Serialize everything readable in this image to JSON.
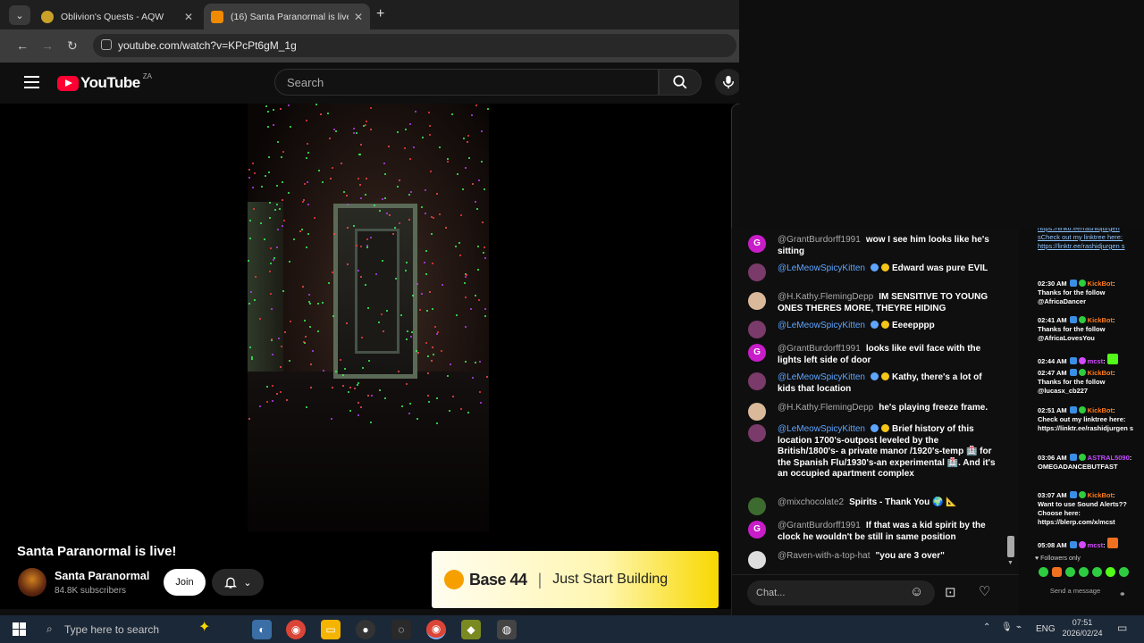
{
  "browser": {
    "tabs": [
      {
        "title": "Oblivion's Quests - AQW"
      },
      {
        "title": "(16) Santa Paranormal is live"
      }
    ],
    "url": "youtube.com/watch?v=KPcPt6gM_1g"
  },
  "youtube": {
    "logo_text": "YouTube",
    "country_code": "ZA",
    "search_placeholder": "Search",
    "video_title": "Santa Paranormal is live!",
    "channel_name": "Santa Paranormal",
    "subscribers": "84.8K subscribers",
    "join_label": "Join"
  },
  "ad": {
    "brand": "Base 44",
    "separator": "|",
    "tagline": "Just Start Building"
  },
  "chat": {
    "input_placeholder": "Chat...",
    "messages": [
      {
        "user": "@GrantBurdorff1991",
        "text": "wow I see him looks like he's sitting",
        "avatar": "G"
      },
      {
        "user": "@LeMeowSpicyKitten",
        "text": "Edward was pure EVIL",
        "avatar": ""
      },
      {
        "user": "@H.Kathy.FlemingDepp",
        "text": "IM SENSITIVE TO YOUNG ONES THERES MORE, THEYRE HIDING",
        "avatar": ""
      },
      {
        "user": "@LeMeowSpicyKitten",
        "text": "Eeeepppp",
        "avatar": ""
      },
      {
        "user": "@GrantBurdorff1991",
        "text": "looks like evil face with the lights left side of door",
        "avatar": "G"
      },
      {
        "user": "@LeMeowSpicyKitten",
        "text": "Kathy, there's a lot of kids that location",
        "avatar": ""
      },
      {
        "user": "@H.Kathy.FlemingDepp",
        "text": "he's playing freeze frame.",
        "avatar": ""
      },
      {
        "user": "@LeMeowSpicyKitten",
        "text": "Brief history of this location 1700's-outpost leveled by the British/1800's- a private manor /1920's-temp 🏥 for the Spanish Flu/1930's-an experimental 🏥. And it's an occupied apartment complex",
        "avatar": ""
      },
      {
        "user": "@mixchocolate2",
        "text": "Spirits - Thank You 🌍 📐",
        "avatar": ""
      },
      {
        "user": "@GrantBurdorff1991",
        "text": "If that was a kid spirit by the clock he wouldn't be still in same position",
        "avatar": "G"
      },
      {
        "user": "@Raven-with-a-top-hat",
        "text": "\"you are 3 over\"",
        "avatar": ""
      }
    ]
  },
  "kick_log": {
    "entries": [
      {
        "time": "",
        "user": "",
        "text": "https://linktr.ee/rashidjurgen sCheck out my linktree here: https://linktr.ee/rashidjurgen s"
      },
      {
        "time": "02:30 AM",
        "user": "KickBot",
        "text": "Thanks for the follow @AfricaDancer"
      },
      {
        "time": "02:41 AM",
        "user": "KickBot",
        "text": "Thanks for the follow @AfricaLovesYou"
      },
      {
        "time": "02:44 AM",
        "user": "mcst",
        "text": ""
      },
      {
        "time": "02:47 AM",
        "user": "KickBot",
        "text": "Thanks for the follow @lucasx_cb227"
      },
      {
        "time": "02:51 AM",
        "user": "KickBot",
        "text": "Check out my linktree here: https://linktr.ee/rashidjurgen s"
      },
      {
        "time": "03:06 AM",
        "user": "ASTRAL5090",
        "text": "OMEGADANCEBUTFAST"
      },
      {
        "time": "03:07 AM",
        "user": "KickBot",
        "text": "Want to use Sound Alerts?? Choose here: https://blerp.com/x/mcst"
      },
      {
        "time": "05:08 AM",
        "user": "mcst",
        "text": ""
      }
    ],
    "followers_only": "Followers only",
    "send_label": "Send a message"
  },
  "taskbar": {
    "search_placeholder": "Type here to search",
    "language": "ENG",
    "time": "07:51",
    "date": "2026/02/24"
  },
  "colors": {
    "youtube_red": "#ff0033",
    "kickbot_orange": "#ff7a1a",
    "mention_blue": "#5ea5ff"
  }
}
